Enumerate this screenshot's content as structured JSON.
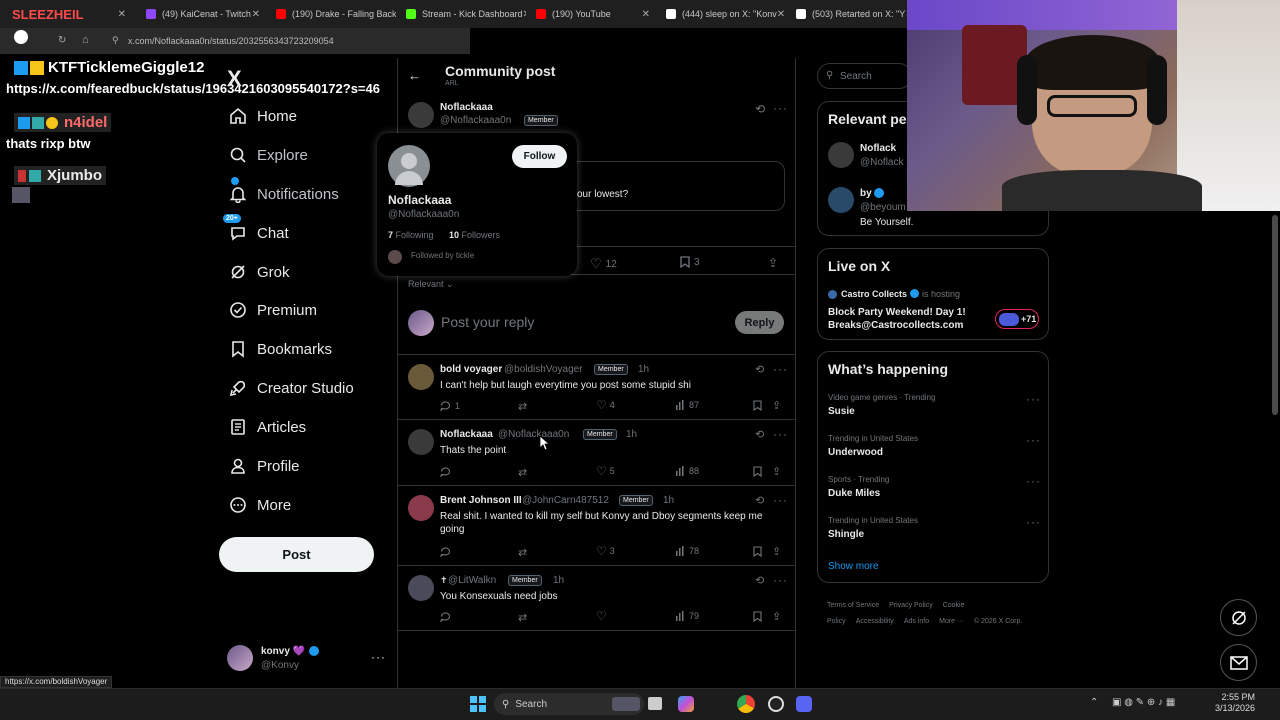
{
  "tabs": [
    {
      "label": "SLEEZHEIL",
      "color": "#c83232"
    },
    {
      "label": "(49) KaiCenat - Twitch",
      "color": "#9146ff"
    },
    {
      "label": "(190) Drake - Falling Back",
      "color": "#ff0000"
    },
    {
      "label": "Stream - Kick Dashboard",
      "color": "#53fc18"
    },
    {
      "label": "(190) YouTube",
      "color": "#ff0000"
    },
    {
      "label": "(444) sleep on X: \"Konv",
      "color": "#ffffff"
    },
    {
      "label": "(503) Retarted on X: \"Y",
      "color": "#ffffff"
    }
  ],
  "address": {
    "url": "x.com/Noflackaaa0n/status/2032556343723209054"
  },
  "chat_overlay": {
    "messages": [
      {
        "user": "KTFTicklemeGiggle12",
        "color": "#ffffff",
        "text": "https://x.com/fearedbuck/status/1963421603095540172?s=46"
      },
      {
        "user": "n4idel",
        "color": "#ff6b6b",
        "text": "thats rixp btw"
      },
      {
        "user": "Xjumbo",
        "color": "#ffffff",
        "text": ""
      }
    ]
  },
  "nav": {
    "logo": "X",
    "items": [
      {
        "label": "Home",
        "icon": "home-icon"
      },
      {
        "label": "Explore",
        "icon": "search-icon"
      },
      {
        "label": "Notifications",
        "icon": "bell-icon"
      },
      {
        "label": "Chat",
        "icon": "chat-icon",
        "badge": "20+"
      },
      {
        "label": "Grok",
        "icon": "grok-icon"
      },
      {
        "label": "Premium",
        "icon": "premium-icon"
      },
      {
        "label": "Bookmarks",
        "icon": "bookmark-icon"
      },
      {
        "label": "Creator Studio",
        "icon": "rocket-icon"
      },
      {
        "label": "Articles",
        "icon": "article-icon"
      },
      {
        "label": "Profile",
        "icon": "person-icon"
      },
      {
        "label": "More",
        "icon": "more-icon"
      }
    ],
    "post_label": "Post",
    "account": {
      "name": "konvy 💜",
      "handle": "@Konvy"
    }
  },
  "main": {
    "header_title": "Community post",
    "header_sub": "ARL",
    "op": {
      "name": "Noflackaaa",
      "handle": "@Noflackaaa0n",
      "badge": "Member",
      "text_fragment": "our lowest?"
    },
    "stats": {
      "likes": "12",
      "bookmarks": "3"
    },
    "sort_label": "Relevant",
    "reply_placeholder": "Post your reply",
    "reply_button": "Reply",
    "replies": [
      {
        "name": "bold voyager",
        "handle": "@boldishVoyager",
        "badge": "Member",
        "time": "1h",
        "text": "I can't help but laugh everytime you post some stupid shi",
        "replies": "1",
        "likes": "4",
        "views": "87"
      },
      {
        "name": "Noflackaaa",
        "handle": "@Noflackaaa0n",
        "badge": "Member",
        "time": "1h",
        "text": "Thats the point",
        "replies": "",
        "likes": "5",
        "views": "88"
      },
      {
        "name": "Brent Johnson III",
        "handle": "@JohnCarn487512",
        "badge": "Member",
        "time": "1h",
        "text": "Real shit. I wanted to kill my self but Konvy and Dboy segments keep me going",
        "replies": "",
        "likes": "3",
        "views": "78"
      },
      {
        "name": "",
        "handle": "@LitWalkn",
        "badge": "Member",
        "time": "1h",
        "text": "You Konsexuals need jobs",
        "replies": "",
        "likes": "",
        "views": "79"
      }
    ]
  },
  "hovercard": {
    "name": "Noflackaaa",
    "handle": "@Noflackaaa0n",
    "follow_label": "Follow",
    "following_count": "7",
    "following_label": "Following",
    "followers_count": "10",
    "followers_label": "Followers",
    "followed_by": "Followed by tickle"
  },
  "right": {
    "search_placeholder": "Search",
    "relevant_title": "Relevant pe",
    "relevant": [
      {
        "name": "Noflack",
        "handle": "@Noflack"
      },
      {
        "name": "by",
        "handle": "@beyoum",
        "bio": "Be Yourself."
      }
    ],
    "live": {
      "title": "Live on X",
      "host": "Castro Collects",
      "hosting": "is hosting",
      "event": "Block Party Weekend! Day 1! Breaks@Castrocollects.com",
      "count": "+71"
    },
    "happening": {
      "title": "What’s happening",
      "trends": [
        {
          "sub": "Video game genres · Trending",
          "name": "Susie"
        },
        {
          "sub": "Trending in United States",
          "name": "Underwood"
        },
        {
          "sub": "Sports · Trending",
          "name": "Duke Miles"
        },
        {
          "sub": "Trending in United States",
          "name": "Shingle"
        }
      ],
      "show_more": "Show more"
    },
    "footer": [
      "Terms of Service",
      "Privacy Policy",
      "Cookie Policy",
      "Accessibility",
      "Ads info",
      "More ···",
      "© 2026 X Corp."
    ]
  },
  "status_url": "https://x.com/boldishVoyager",
  "taskbar": {
    "search": "Search",
    "time": "2:55 PM",
    "date": "3/13/2026"
  },
  "colors": {
    "accent": "#1d9bf0",
    "bg": "#000000",
    "border": "#2f3336",
    "muted": "#71767b"
  }
}
